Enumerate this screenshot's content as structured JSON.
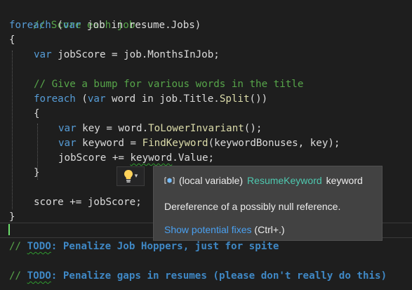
{
  "code": {
    "l1_comment": "// Score each job",
    "l2_foreach": "foreach",
    "l2_open": " (",
    "l2_var": "var",
    "l2_rest": " job in resume.Jobs)",
    "l3_brace": "{",
    "l4_var": "var",
    "l4_a": " jobScore = job.",
    "l4_prop": "MonthsInJob",
    "l4_end": ";",
    "l6_comment": "// Give a bump for various words in the title",
    "l7_foreach": "foreach",
    "l7_open": " (",
    "l7_var": "var",
    "l7_a": " word in job.Title.",
    "l7_fn": "Split",
    "l7_end": "())",
    "l8_brace": "{",
    "l9_var": "var",
    "l9_a": " key = word.",
    "l9_fn": "ToLowerInvariant",
    "l9_end": "();",
    "l10_var": "var",
    "l10_a": " keyword = ",
    "l10_fn": "FindKeyword",
    "l10_end": "(keywordBonuses, key);",
    "l11_a": "jobScore += ",
    "l11_sq": "keyword",
    "l11_end": ".Value;",
    "l12_brace": "}",
    "l14_text": "score += jobScore;",
    "l15_brace": "}",
    "l17_slash": "// ",
    "l17_todo": "TODO",
    "l17_rest": ": Penalize Job Hoppers, just for spite",
    "l19_slash": "// ",
    "l19_todo": "TODO",
    "l19_rest": ": Penalize gaps in resumes (please don't really do this)"
  },
  "tooltip": {
    "icon": "local-variable-icon",
    "kind": "(local variable)",
    "type": "ResumeKeyword",
    "name": "keyword",
    "message": "Dereference of a possibly null reference.",
    "fix_link": "Show potential fixes",
    "fix_shortcut": "(Ctrl+.)"
  },
  "lightbulb": {
    "icon": "lightbulb-icon",
    "menu_icon": "chevron-down-icon"
  },
  "colors": {
    "background": "#1e1e1e",
    "keyword": "#569cd6",
    "comment": "#57a64a",
    "type": "#4ec9b0",
    "method": "#dcdcaa",
    "text": "#dcdcdc",
    "todo": "#3f88c5",
    "tooltip_bg": "#424242",
    "link": "#4aa0f0",
    "lightbulb": "#ffd35a"
  }
}
